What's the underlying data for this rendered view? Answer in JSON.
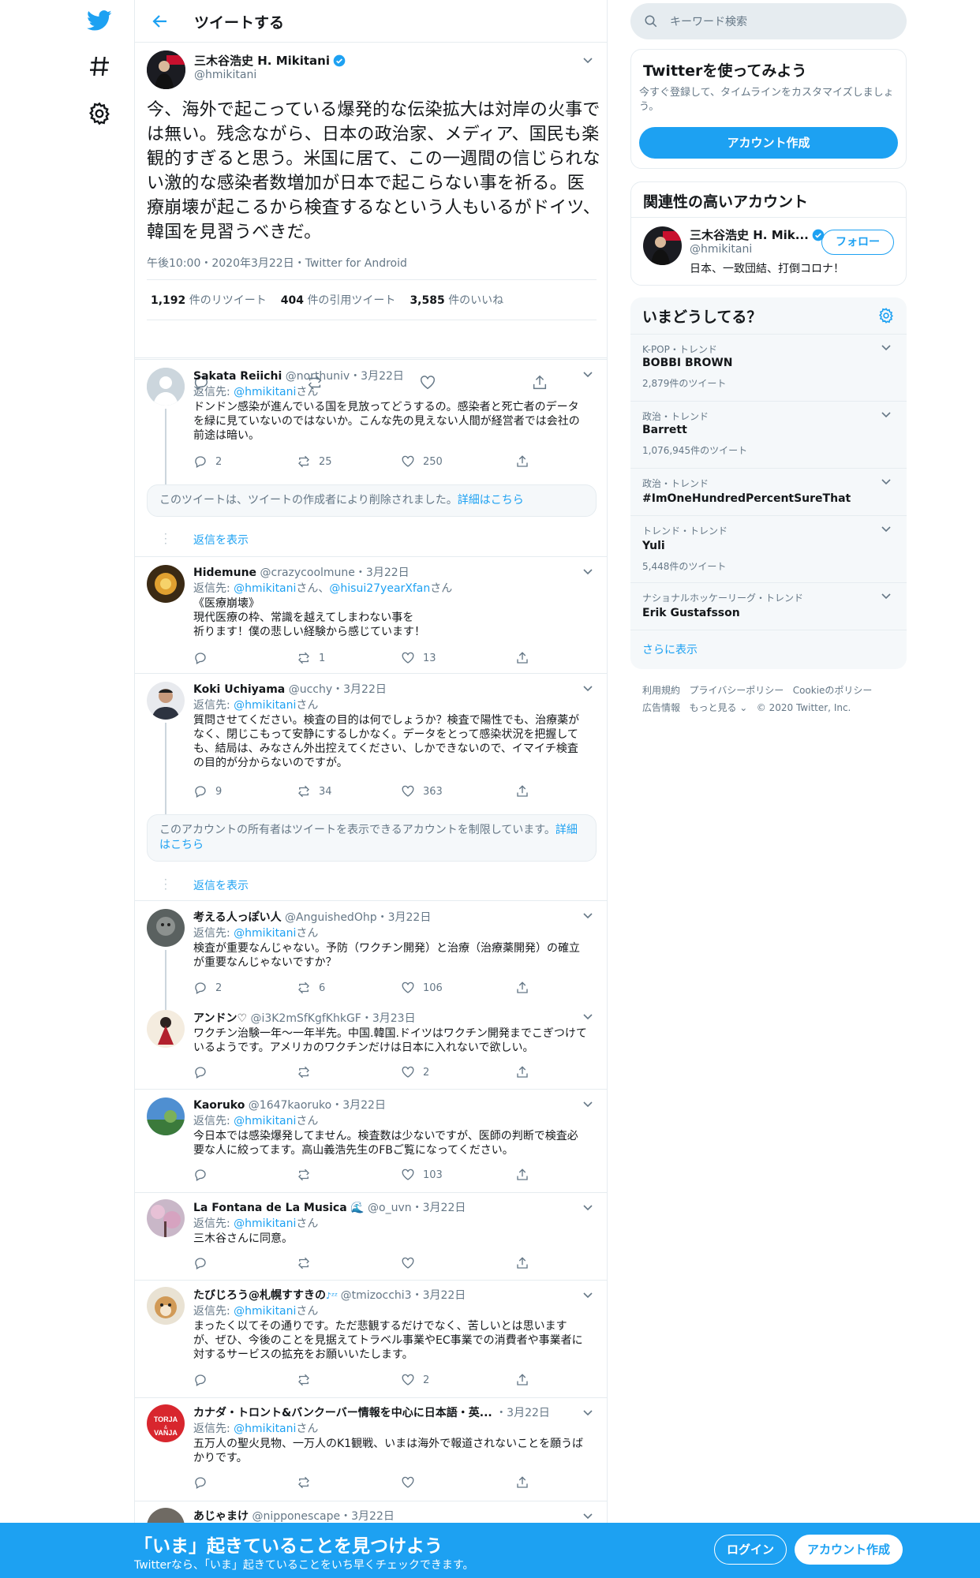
{
  "header": {
    "title": "ツイートする"
  },
  "main_tweet": {
    "name": "三木谷浩史 H. Mikitani",
    "handle": "@hmikitani",
    "text": "今、海外で起こっている爆発的な伝染拡大は対岸の火事では無い。残念ながら、日本の政治家、メディア、国民も楽観的すぎると思う。米国に居て、この一週間の信じられない激的な感染者数増加が日本で起こらない事を祈る。医療崩壊が起こるから検査するなという人もいるがドイツ、韓国を見習うべきだ。",
    "meta": "午後10:00・2020年3月22日・Twitter for Android",
    "retweets": "1,192",
    "retweets_label": "件のリツイート",
    "quotes": "404",
    "quotes_label": "件の引用ツイート",
    "likes": "3,585",
    "likes_label": "件のいいね"
  },
  "replies": [
    {
      "name": "Sakata Reiichi",
      "handle": "@northuniv",
      "date": "・3月22日",
      "to_prefix": "返信先: ",
      "to": "@hmikitani",
      "to_suffix": "さん",
      "text": "ドンドン感染が進んでいる国を見放ってどうするの。感染者と死亡者のデータを緑に見ていないのではないか。こんな先の見えない人間が経営者では会社の前途は暗い。",
      "reply_count": "2",
      "rt_count": "25",
      "like_count": "250"
    },
    {
      "name": "Hidemune",
      "handle": "@crazycoolmune",
      "date": "・3月22日",
      "to_prefix": "返信先: ",
      "to": "@hmikitani",
      "to_mid": "さん、",
      "to2": "@hisui27yearXfan",
      "to_suffix": "さん",
      "text": "《医療崩壊》\n現代医療の枠、常識を越えてしまわない事を\n祈ります！僕の悲しい経験から感じています！",
      "reply_count": "",
      "rt_count": "1",
      "like_count": "13"
    },
    {
      "name": "Koki Uchiyama",
      "handle": "@ucchy",
      "date": "・3月22日",
      "to_prefix": "返信先: ",
      "to": "@hmikitani",
      "to_suffix": "さん",
      "text": "質問させてください。検査の目的は何でしょうか？検査で陽性でも、治療薬がなく、閉じこもって安静にするしかなく。データをとって感染状況を把握しても、結局は、みなさん外出控えてください、しかできないので、イマイチ検査の目的が分からないのですが。",
      "reply_count": "9",
      "rt_count": "34",
      "like_count": "363"
    },
    {
      "name": "考える人っぽい人",
      "handle": "@AnguishedOhp",
      "date": "・3月22日",
      "to_prefix": "返信先: ",
      "to": "@hmikitani",
      "to_suffix": "さん",
      "text": "検査が重要なんじゃない。予防（ワクチン開発）と治療（治療薬開発）の確立が重要なんじゃないですか？",
      "reply_count": "2",
      "rt_count": "6",
      "like_count": "106"
    },
    {
      "name": "アンドン♡",
      "handle": "@i3K2mSfKgfKhkGF",
      "date": "・3月23日",
      "text": "ワクチン治験一年～一年半先。中国.韓国.ドイツはワクチン開発までこぎつけているようです。アメリカのワクチンだけは日本に入れないで欲しい。",
      "reply_count": "",
      "rt_count": "",
      "like_count": "2"
    },
    {
      "name": "Kaoruko",
      "handle": "@1647kaoruko",
      "date": "・3月22日",
      "to_prefix": "返信先: ",
      "to": "@hmikitani",
      "to_suffix": "さん",
      "text": "今日本では感染爆発してません。検査数は少ないですが、医師の判断で検査必要な人に絞ってます。高山義浩先生のFBご覧になってください。",
      "reply_count": "",
      "rt_count": "",
      "like_count": "103"
    },
    {
      "name": "La Fontana de La Musica",
      "handle": "@o_uvn",
      "date": "・3月22日",
      "to_prefix": "返信先: ",
      "to": "@hmikitani",
      "to_suffix": "さん",
      "text": "三木谷さんに同意。",
      "reply_count": "",
      "rt_count": "",
      "like_count": ""
    },
    {
      "name": "たびじろう@札幌すすきの",
      "handle": "@tmizocchi3",
      "date": "・3月22日",
      "to_prefix": "返信先: ",
      "to": "@hmikitani",
      "to_suffix": "さん",
      "text": "まったく以てその通りです。ただ悲観するだけでなく、苦しいとは思いますが、ぜひ、今後のことを見据えてトラベル事業やEC事業での消費者や事業者に対するサービスの拡充をお願いいたします。",
      "reply_count": "",
      "rt_count": "",
      "like_count": "2"
    },
    {
      "name": "カナダ・トロント&バンクーバー情報を中心に日本語・英...",
      "handle": "",
      "date": "・3月22日",
      "to_prefix": "返信先: ",
      "to": "@hmikitani",
      "to_suffix": "さん",
      "text": "五万人の聖火見物、一万人のK1観戦、いまは海外で報道されないことを願うばかりです。",
      "reply_count": "",
      "rt_count": "",
      "like_count": ""
    },
    {
      "name": "あじゃまけ",
      "handle": "@nipponescape",
      "date": "・3月22日"
    }
  ],
  "notices": {
    "deleted": "このツイートは、ツイートの作成者により削除されました。",
    "deleted_link": "詳細はこちら",
    "restricted": "このアカウントの所有者はツイートを表示できるアカウントを制限しています。",
    "restricted_link": "詳細はこちら",
    "show_replies": "返信を表示"
  },
  "sidebar": {
    "search_placeholder": "キーワード検索",
    "signup_card": {
      "title": "Twitterを使ってみよう",
      "desc": "今すぐ登録して、タイムラインをカスタマイズしましょう。",
      "button": "アカウント作成"
    },
    "related": {
      "title": "関連性の高いアカウント",
      "name": "三木谷浩史 H. Mik...",
      "handle": "@hmikitani",
      "bio": "日本、一致団結、打倒コロナ！",
      "follow": "フォロー"
    },
    "trends": {
      "title": "いまどうしてる？",
      "items": [
        {
          "cat": "K-POP・トレンド",
          "name": "BOBBI BROWN",
          "count": "2,879件のツイート"
        },
        {
          "cat": "政治・トレンド",
          "name": "Barrett",
          "count": "1,076,945件のツイート"
        },
        {
          "cat": "政治・トレンド",
          "name": "#ImOneHundredPercentSureThat",
          "count": ""
        },
        {
          "cat": "トレンド・トレンド",
          "name": "Yuli",
          "count": "5,448件のツイート"
        },
        {
          "cat": "ナショナルホッケーリーグ・トレンド",
          "name": "Erik Gustafsson",
          "count": ""
        }
      ],
      "more": "さらに表示"
    },
    "footer": {
      "line1": [
        "利用規約",
        "プライバシーポリシー",
        "Cookieのポリシー"
      ],
      "line2": [
        "広告情報",
        "もっと見る ⌄",
        "© 2020 Twitter, Inc."
      ]
    }
  },
  "bottom_bar": {
    "title": "「いま」起きていることを見つけよう",
    "subtitle": "Twitterなら、「いま」起きていることをいち早くチェックできます。",
    "login": "ログイン",
    "signup": "アカウント作成"
  },
  "colors": {
    "accent": "#1da1f2",
    "muted": "#657786",
    "border": "#e6ecf0"
  }
}
